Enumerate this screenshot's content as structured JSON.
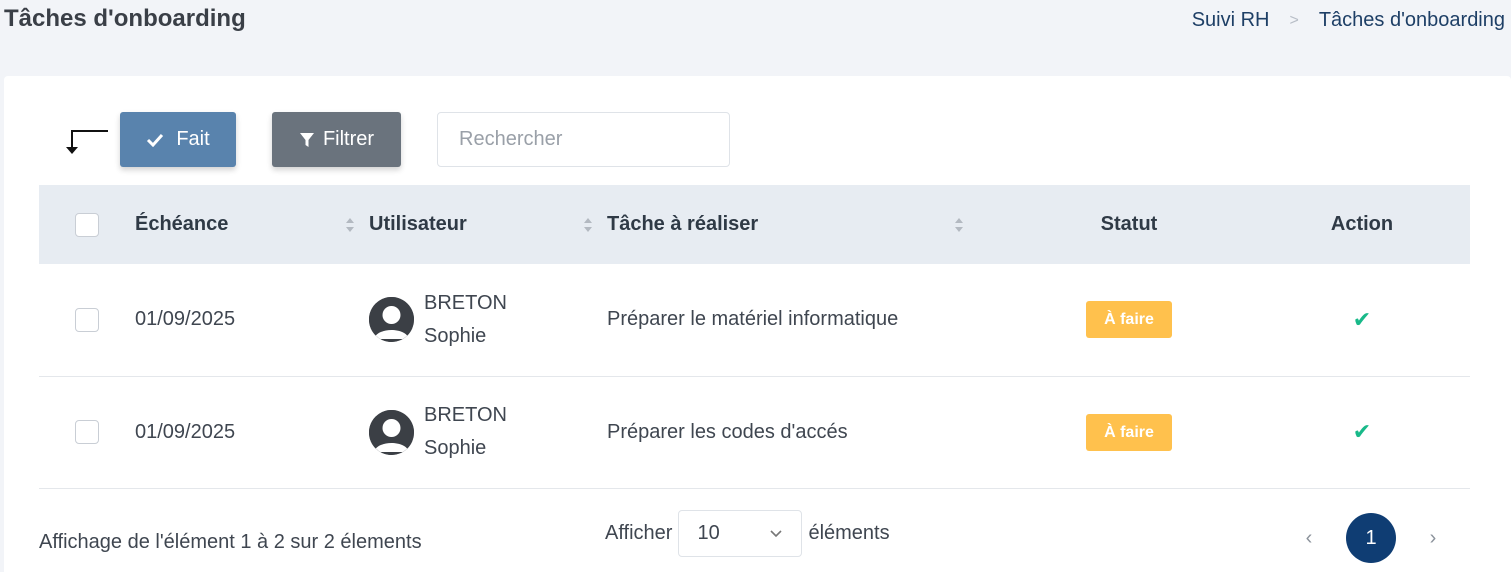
{
  "header": {
    "title": "Tâches d'onboarding",
    "breadcrumb": [
      "Suivi RH",
      "Tâches d'onboarding"
    ]
  },
  "toolbar": {
    "done_label": "Fait",
    "filter_label": "Filtrer",
    "search_placeholder": "Rechercher",
    "search_value": ""
  },
  "table": {
    "columns": [
      "Échéance",
      "Utilisateur",
      "Tâche à réaliser",
      "Statut",
      "Action"
    ],
    "rows": [
      {
        "due": "01/09/2025",
        "user_last": "BRETON",
        "user_first": "Sophie",
        "task": "Préparer le matériel informatique",
        "status": "À faire"
      },
      {
        "due": "01/09/2025",
        "user_last": "BRETON",
        "user_first": "Sophie",
        "task": "Préparer les codes d'accés",
        "status": "À faire"
      }
    ]
  },
  "footer": {
    "info": "Affichage de l'élément 1 à 2 sur 2 élements",
    "show_label": "Afficher",
    "page_size": "10",
    "items_label": "éléments",
    "current_page": "1"
  },
  "colors": {
    "done_button": "#5983ad",
    "filter_button": "#6a737d",
    "status_todo": "#ffc14d",
    "action_check": "#18b989",
    "active_page": "#0f3d73"
  },
  "icons": [
    "return-arrow-icon",
    "check-icon",
    "filter-icon",
    "sort-icon",
    "avatar-icon",
    "chevron-down-icon",
    "chevron-left-icon",
    "chevron-right-icon"
  ]
}
